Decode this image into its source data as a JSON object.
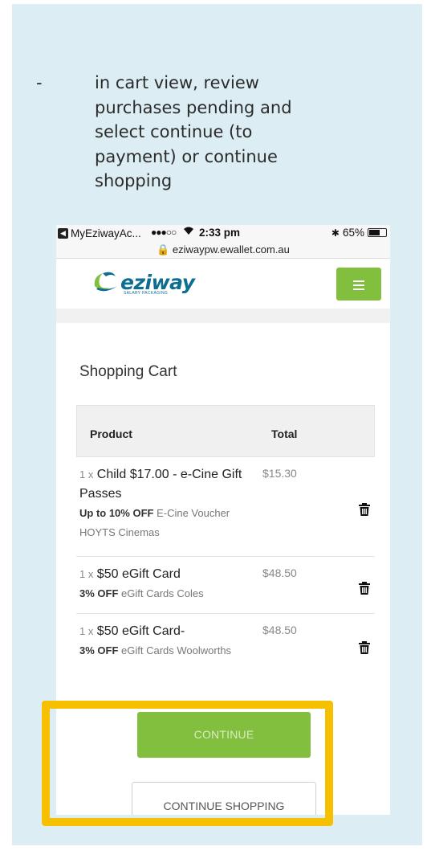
{
  "instruction": {
    "dash": "-",
    "text": "in cart view, review purchases pending and select continue (to payment) or continue shopping"
  },
  "statusbar": {
    "app": "MyEziwayAc...",
    "signal": "●●●○○",
    "time": "2:33 pm",
    "battery": "65%",
    "battery_level": 0.65
  },
  "urlbar": {
    "url": "eziwaypw.ewallet.com.au"
  },
  "logo": {
    "word": "eziway",
    "tagline": "SALARY PACKAGING"
  },
  "cart": {
    "title": "Shopping Cart",
    "col_product": "Product",
    "col_total": "Total",
    "rows": [
      {
        "qty": "1 x",
        "name": "Child $17.00 - e-Cine Gift Passes",
        "discount": "Up to 10% OFF",
        "desc": "E-Cine Voucher HOYTS Cinemas",
        "price": "$15.30"
      },
      {
        "qty": "1 x",
        "name": "$50 eGift Card",
        "discount": "3% OFF",
        "desc": "eGift Cards Coles",
        "price": "$48.50"
      },
      {
        "qty": "1 x",
        "name": "$50 eGift Card-",
        "discount": "3% OFF",
        "desc": "eGift Cards Woolworths",
        "price": "$48.50"
      }
    ]
  },
  "buttons": {
    "continue": "CONTINUE",
    "continue_shopping": "CONTINUE SHOPPING"
  },
  "colors": {
    "panel": "#dceef3",
    "accent_green": "#83bf3f",
    "highlight": "#f6c000",
    "brand_blue": "#0d6e91"
  }
}
